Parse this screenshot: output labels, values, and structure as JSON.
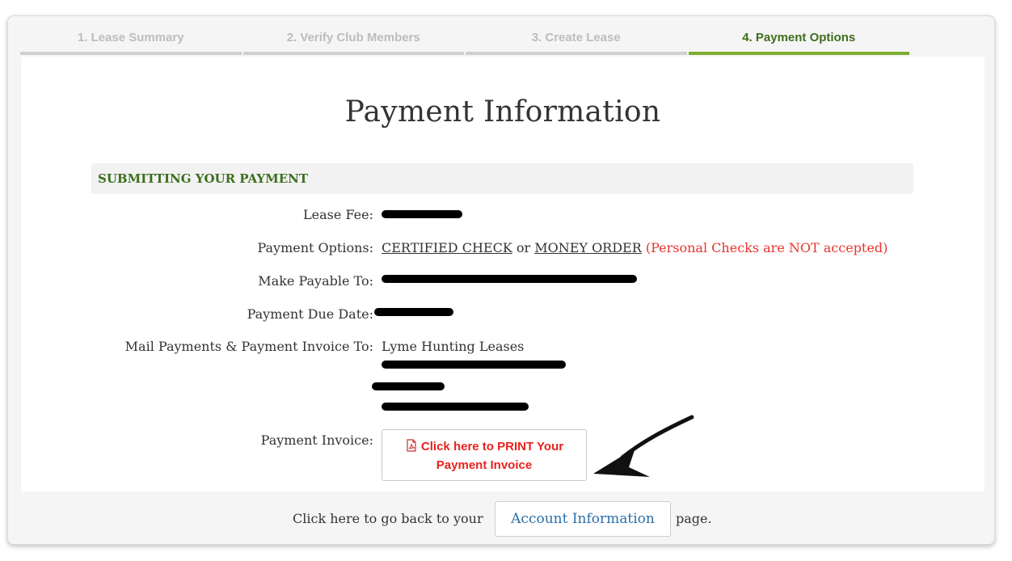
{
  "steps": [
    {
      "label": "1. Lease Summary",
      "active": false
    },
    {
      "label": "2. Verify Club Members",
      "active": false
    },
    {
      "label": "3. Create Lease",
      "active": false
    },
    {
      "label": "4. Payment Options",
      "active": true
    }
  ],
  "page": {
    "title": "Payment Information",
    "section_heading": "SUBMITTING YOUR PAYMENT"
  },
  "fields": {
    "lease_fee_label": "Lease Fee:",
    "payment_options_label": "Payment Options:",
    "payment_option_1": "CERTIFIED CHECK",
    "payment_option_or": "or",
    "payment_option_2": "MONEY ORDER",
    "payment_options_note": "(Personal Checks are NOT accepted)",
    "payable_to_label": "Make Payable To:",
    "due_date_label": "Payment Due Date:",
    "mail_to_label": "Mail Payments & Payment Invoice To:",
    "mail_to_line1": "Lyme Hunting Leases",
    "invoice_label": "Payment Invoice:"
  },
  "invoice_button": {
    "line1": "Click here to PRINT Your",
    "line2": "Payment Invoice"
  },
  "footer": {
    "prefix": "Click here to go back to your",
    "button": "Account Information",
    "suffix": "page."
  },
  "colors": {
    "active_step": "#7aad2e",
    "section_heading": "#3b6f1e",
    "warning_red": "#e8342c",
    "link_blue": "#2a6ea8"
  }
}
